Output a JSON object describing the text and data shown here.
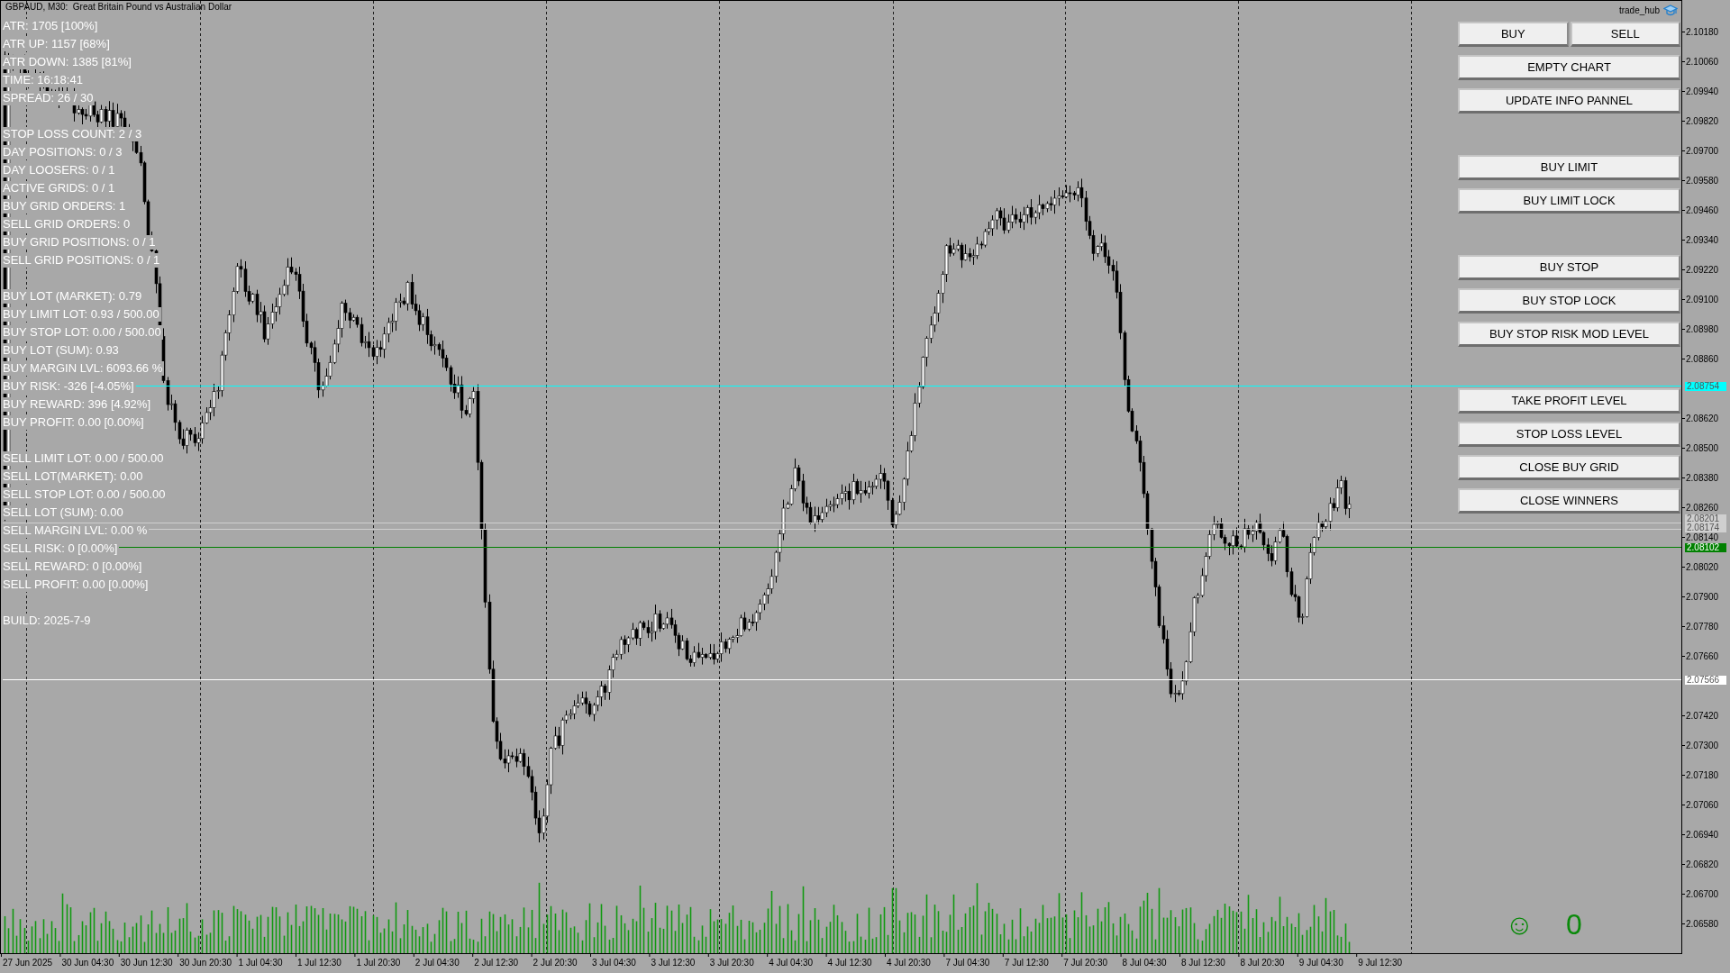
{
  "chart": {
    "title": "GBPAUD, M30:  Great Britain Pound vs Australian Dollar"
  },
  "info_groups": [
    [
      "ATR: 1705 [100%]",
      "ATR UP: 1157 [68%]",
      "ATR DOWN: 1385 [81%]",
      "TIME: 16:18:41",
      "SPREAD: 26 / 30"
    ],
    [
      "STOP LOSS COUNT: 2 / 3",
      "DAY POSITIONS: 0 / 3",
      "DAY LOOSERS: 0 / 1",
      "ACTIVE GRIDS: 0 / 1",
      "BUY GRID ORDERS: 1",
      "SELL GRID ORDERS: 0",
      "BUY GRID POSITIONS: 0 / 1",
      "SELL GRID POSITIONS: 0 / 1"
    ],
    [
      "BUY LOT (MARKET): 0.79",
      "BUY LIMIT LOT: 0.93 / 500.00",
      "BUY STOP LOT: 0.00 / 500.00",
      "BUY LOT (SUM): 0.93",
      "BUY MARGIN LVL: 6093.66 %",
      "BUY RISK: -326 [-4.05%]",
      "BUY REWARD: 396 [4.92%]",
      "BUY PROFIT: 0.00 [0.00%]"
    ],
    [
      "SELL LIMIT LOT: 0.00 / 500.00",
      "SELL LOT(MARKET): 0.00",
      "SELL STOP LOT: 0.00 / 500.00",
      "SELL LOT (SUM): 0.00",
      "SELL MARGIN LVL: 0.00 %",
      "SELL RISK: 0 [0.00%]",
      "SELL REWARD: 0 [0.00%]",
      "SELL PROFIT: 0.00 [0.00%]"
    ],
    [
      "BUILD: 2025-7-9"
    ]
  ],
  "panel": {
    "label": "trade_hub",
    "button_groups": [
      [
        [
          "BUY",
          "SELL"
        ],
        [
          "EMPTY CHART"
        ],
        [
          "UPDATE INFO PANNEL"
        ]
      ],
      [
        [
          "BUY LIMIT"
        ],
        [
          "BUY LIMIT LOCK"
        ]
      ],
      [
        [
          "BUY STOP"
        ],
        [
          "BUY STOP LOCK"
        ],
        [
          "BUY STOP RISK MOD LEVEL"
        ]
      ],
      [
        [
          "TAKE PROFIT LEVEL"
        ],
        [
          "STOP LOSS LEVEL"
        ],
        [
          "CLOSE BUY GRID"
        ],
        [
          "CLOSE WINNERS"
        ]
      ]
    ]
  },
  "price_axis": [
    "2.10180",
    "2.10060",
    "2.09940",
    "2.09820",
    "2.09700",
    "2.09580",
    "2.09460",
    "2.09340",
    "2.09220",
    "2.09100",
    "2.08980",
    "2.08860",
    "2.08620",
    "2.08500",
    "2.08380",
    "2.08260",
    "2.08140",
    "2.08020",
    "2.07900",
    "2.07780",
    "2.07660",
    "2.07420",
    "2.07300",
    "2.07180",
    "2.07060",
    "2.06940",
    "2.06820",
    "2.06700",
    "2.06580"
  ],
  "price_lines": [
    {
      "label": "2.08754",
      "color": "#00ffff"
    },
    {
      "label": "2.08201",
      "color": "#cfcfcf"
    },
    {
      "label": "2.08174",
      "color": "#cfcfcf"
    },
    {
      "label": "2.08102",
      "color": "#008000"
    },
    {
      "label": "2.07566",
      "color": "#ffffff"
    }
  ],
  "time_axis": [
    "27 Jun 2025",
    "30 Jun 04:30",
    "30 Jun 12:30",
    "30 Jun 20:30",
    "1 Jul 04:30",
    "1 Jul 12:30",
    "1 Jul 20:30",
    "2 Jul 04:30",
    "2 Jul 12:30",
    "2 Jul 20:30",
    "3 Jul 04:30",
    "3 Jul 12:30",
    "3 Jul 20:30",
    "4 Jul 04:30",
    "4 Jul 12:30",
    "4 Jul 20:30",
    "7 Jul 04:30",
    "7 Jul 12:30",
    "7 Jul 20:30",
    "8 Jul 04:30",
    "8 Jul 12:30",
    "8 Jul 20:30",
    "9 Jul 04:30",
    "9 Jul 12:30"
  ],
  "status": {
    "symbol": "☺",
    "count": "0"
  }
}
